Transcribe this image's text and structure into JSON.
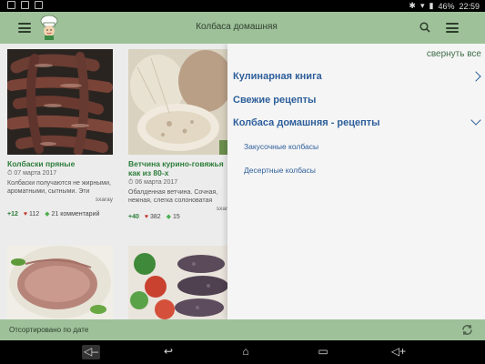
{
  "status_bar": {
    "time": "22:59",
    "battery": "46%"
  },
  "toolbar": {
    "title": "Колбаса домашняя"
  },
  "cards": [
    {
      "title": "Колбаски пряные",
      "date": "07 марта 2017",
      "description": "Колбаски получаются не жирными, ароматными, сытными. Эти колбаски можно как...",
      "author": "sxaray",
      "plus": "+12",
      "likes": "112",
      "comments": "21 комментарий"
    },
    {
      "title": "Ветчина курино-говяжья как из 80-х",
      "date": "06 марта 2017",
      "description": "Обалденная ветчина. Сочная, нежная, слегка солоноватая",
      "author": "sxaray",
      "plus": "+40",
      "likes": "382",
      "comments": "15"
    }
  ],
  "drawer": {
    "collapse_label": "свернуть все",
    "items": [
      {
        "label": "Кулинарная книга"
      },
      {
        "label": "Свежие рецепты"
      },
      {
        "label": "Колбаса домашняя - рецепты"
      }
    ],
    "subitems": [
      {
        "label": "Закусочные колбасы"
      },
      {
        "label": "Десертные колбасы"
      }
    ]
  },
  "sort_bar": {
    "label": "Отсортировано по дате"
  },
  "colors": {
    "toolbar": "#9ec19a",
    "link_blue": "#2d5e9a",
    "title_green": "#2c7d3a"
  }
}
